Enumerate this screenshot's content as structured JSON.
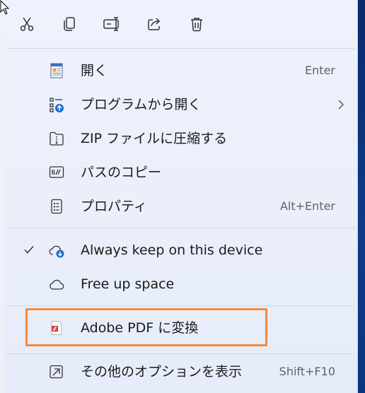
{
  "toolbar": {
    "buttons": [
      {
        "name": "cut",
        "icon": "scissors-icon"
      },
      {
        "name": "copy",
        "icon": "copy-icon"
      },
      {
        "name": "rename",
        "icon": "rename-icon"
      },
      {
        "name": "share",
        "icon": "share-icon"
      },
      {
        "name": "delete",
        "icon": "trash-icon"
      }
    ]
  },
  "menu": {
    "items": [
      {
        "label": "開く",
        "shortcut": "Enter",
        "icon": "document-icon"
      },
      {
        "label": "プログラムから開く",
        "shortcut": "",
        "icon": "open-with-icon",
        "submenu": true
      },
      {
        "label": "ZIP ファイルに圧縮する",
        "shortcut": "",
        "icon": "zip-folder-icon"
      },
      {
        "label": "パスのコピー",
        "shortcut": "",
        "icon": "copy-path-icon"
      },
      {
        "label": "プロパティ",
        "shortcut": "Alt+Enter",
        "icon": "properties-icon"
      },
      {
        "label": "Always keep on this device",
        "shortcut": "",
        "icon": "cloud-sync-icon",
        "checked": true
      },
      {
        "label": "Free up space",
        "shortcut": "",
        "icon": "cloud-icon"
      },
      {
        "label": "Adobe PDF に変換",
        "shortcut": "",
        "icon": "adobe-pdf-icon"
      },
      {
        "label": "その他のオプションを表示",
        "shortcut": "Shift+F10",
        "icon": "more-options-icon"
      }
    ]
  },
  "colors": {
    "highlight_border": "#f5893a",
    "accent": "#1a6fd6"
  }
}
